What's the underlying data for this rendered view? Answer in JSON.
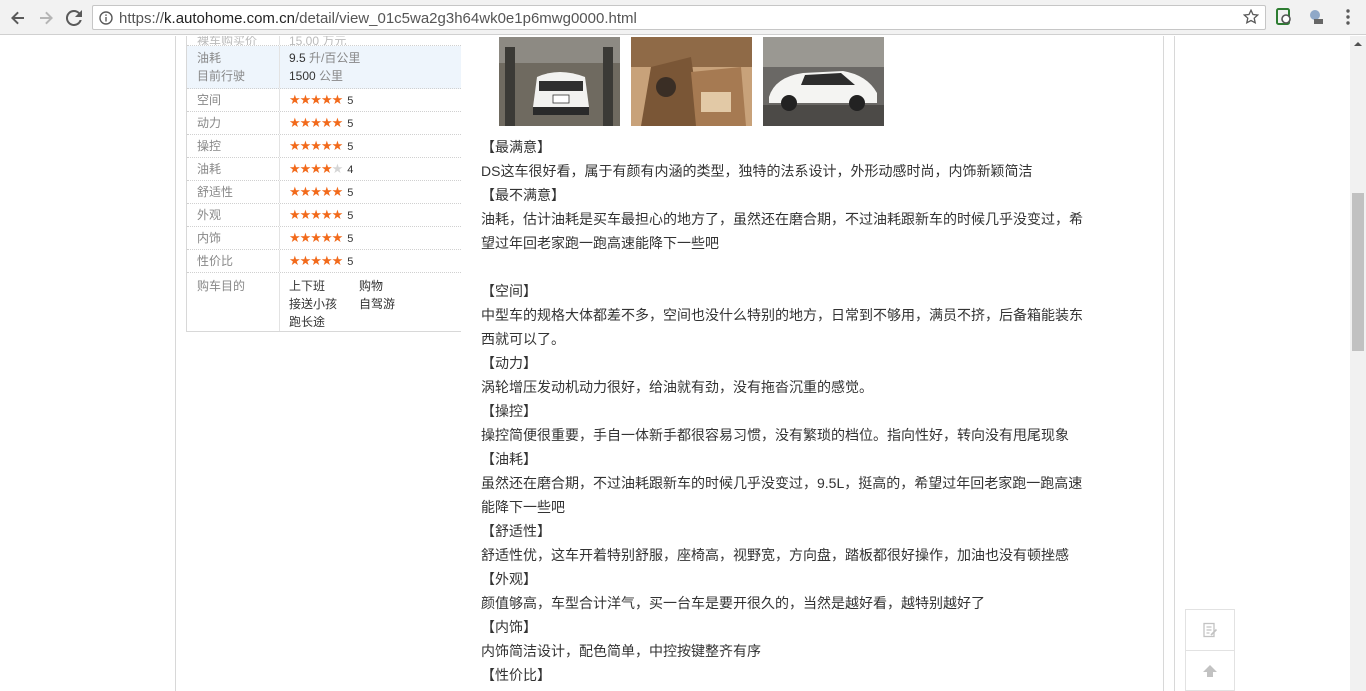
{
  "browser": {
    "url_prefix": "https://",
    "url_host": "k.autohome.com.cn",
    "url_path": "/detail/view_01c5wa2g3h64wk0e1p6mwg0000.html"
  },
  "specs": {
    "top_partial": {
      "label": "裸车购买价",
      "value": "15.00 万元"
    },
    "fuel": {
      "label": "油耗",
      "value": "9.5",
      "unit": "升/百公里"
    },
    "mileage": {
      "label": "目前行驶",
      "value": "1500",
      "unit": "公里"
    },
    "ratings": [
      {
        "label": "空间",
        "score": 5
      },
      {
        "label": "动力",
        "score": 5
      },
      {
        "label": "操控",
        "score": 5
      },
      {
        "label": "油耗",
        "score": 4
      },
      {
        "label": "舒适性",
        "score": 5
      },
      {
        "label": "外观",
        "score": 5
      },
      {
        "label": "内饰",
        "score": 5
      },
      {
        "label": "性价比",
        "score": 5
      }
    ],
    "purpose": {
      "label": "购车目的",
      "items": [
        "上下班",
        "购物",
        "接送小孩",
        "自驾游",
        "跑长途"
      ]
    }
  },
  "photos": [
    {
      "name": "photo-front"
    },
    {
      "name": "photo-interior"
    },
    {
      "name": "photo-side"
    }
  ],
  "review": {
    "lines": [
      "【最满意】",
      "DS这车很好看，属于有颜有内涵的类型，独特的法系设计，外形动感时尚，内饰新颖简洁",
      "【最不满意】",
      "油耗，估计油耗是买车最担心的地方了，虽然还在磨合期，不过油耗跟新车的时候几乎没变过，希",
      "望过年回老家跑一跑高速能降下一些吧",
      "",
      "【空间】",
      "中型车的规格大体都差不多，空间也没什么特别的地方，日常到不够用，满员不挤，后备箱能装东",
      "西就可以了。",
      "【动力】",
      "涡轮增压发动机动力很好，给油就有劲，没有拖沓沉重的感觉。",
      "【操控】",
      "操控简便很重要，手自一体新手都很容易习惯，没有繁琐的档位。指向性好，转向没有甩尾现象",
      "【油耗】",
      "虽然还在磨合期，不过油耗跟新车的时候几乎没变过，9.5L，挺高的，希望过年回老家跑一跑高速",
      "能降下一些吧",
      "【舒适性】",
      "舒适性优，这车开着特别舒服，座椅高，视野宽，方向盘，踏板都很好操作，加油也没有顿挫感",
      "【外观】",
      "颜值够高，车型合计洋气，买一台车是要开很久的，当然是越好看，越特别越好了",
      "【内饰】",
      "内饰简洁设计，配色简单，中控按键整齐有序",
      "【性价比】"
    ]
  },
  "colors": {
    "star_on": "#f26a1b",
    "star_off": "#d6d6d6",
    "highlight_row": "#eef5fc"
  }
}
